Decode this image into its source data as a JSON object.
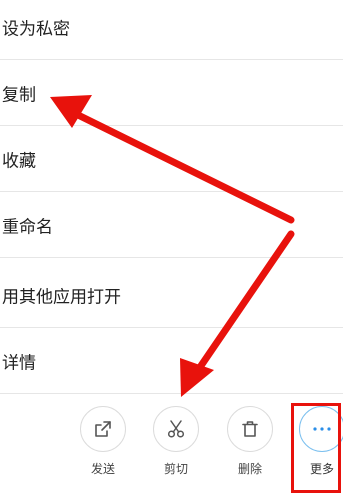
{
  "menu": {
    "items": [
      {
        "label": "设为私密"
      },
      {
        "label": "复制"
      },
      {
        "label": "收藏"
      },
      {
        "label": "重命名"
      },
      {
        "label": "用其他应用打开"
      },
      {
        "label": "详情"
      }
    ]
  },
  "toolbar": {
    "buttons": [
      {
        "label": "发送",
        "icon": "share-icon"
      },
      {
        "label": "剪切",
        "icon": "scissors-icon"
      },
      {
        "label": "删除",
        "icon": "trash-icon"
      },
      {
        "label": "更多",
        "icon": "more-dots-icon"
      }
    ]
  },
  "colors": {
    "annotation": "#e8120c",
    "accent": "#2a8ee8"
  }
}
